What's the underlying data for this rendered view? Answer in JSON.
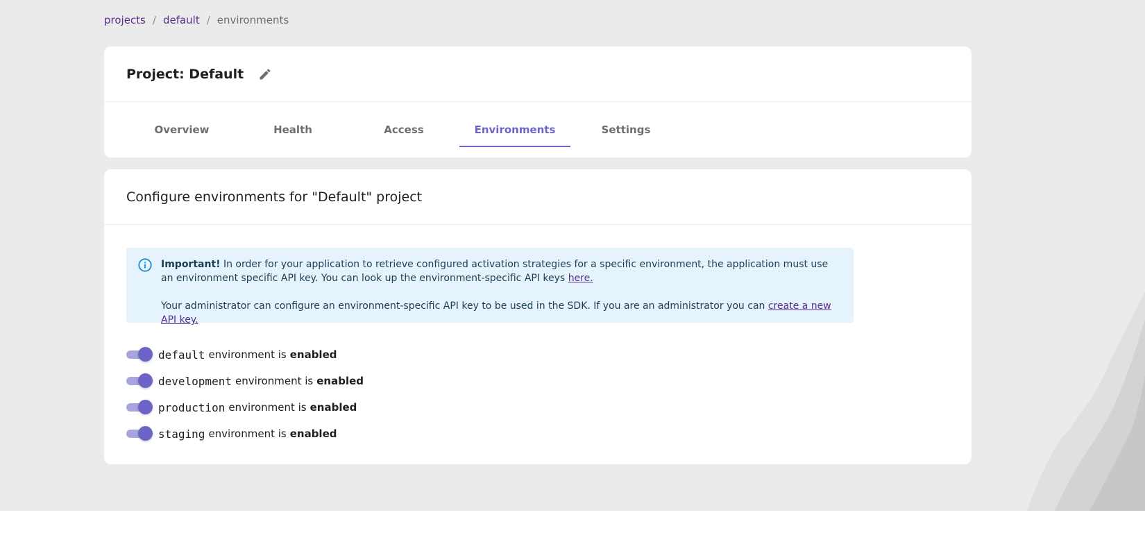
{
  "breadcrumb": {
    "items": [
      "projects",
      "default"
    ],
    "separator": "/",
    "current": "environments"
  },
  "header": {
    "title": "Project: Default",
    "edit_icon": "pencil-icon"
  },
  "tabs": [
    {
      "label": "Overview",
      "active": false
    },
    {
      "label": "Health",
      "active": false
    },
    {
      "label": "Access",
      "active": false
    },
    {
      "label": "Environments",
      "active": true
    },
    {
      "label": "Settings",
      "active": false
    }
  ],
  "environments_panel": {
    "heading": "Configure environments for \"Default\" project",
    "info": {
      "icon": "info-icon",
      "important_label": "Important!",
      "line1": " In order for your application to retrieve configured activation strategies for a specific environment, the application must use an environment specific API key. You can look up the environment-specific API keys ",
      "link1": "here.",
      "line2": "Your administrator can configure an environment-specific API key to be used in the SDK. If you are an administrator you can ",
      "link2": "create a new API key."
    },
    "environments": [
      {
        "name": "default",
        "mid": "environment is",
        "state": "enabled"
      },
      {
        "name": "development",
        "mid": "environment is",
        "state": "enabled"
      },
      {
        "name": "production",
        "mid": "environment is",
        "state": "enabled"
      },
      {
        "name": "staging",
        "mid": "environment is",
        "state": "enabled"
      }
    ]
  },
  "colors": {
    "accent": "#6c65c7",
    "link": "#5c2d91",
    "info_bg": "#e5f3fc",
    "page_bg": "#ebebeb"
  }
}
